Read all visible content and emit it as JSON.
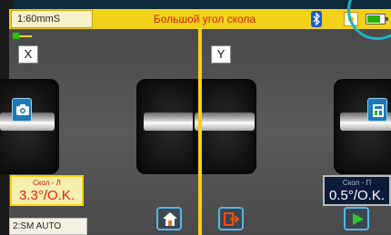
{
  "status_bar": {
    "speed": "1:60mmS",
    "title": "Большой угол скола"
  },
  "panes": {
    "x_label": "X",
    "y_label": "Y"
  },
  "cleave_left": {
    "label": "Скол - Л",
    "value": "3.3°/O.K."
  },
  "cleave_right": {
    "label": "Скол - П",
    "value": "0.5°/O.K."
  },
  "mode": "2:SM AUTO",
  "colors": {
    "status_bar": "#f2d21a",
    "title_text": "#d0201a",
    "divider": "#f2d21a",
    "button_accent": "#56b8e8",
    "cleave_left_value": "#e02010"
  },
  "icons": [
    "bluetooth-icon",
    "brightness-icon",
    "battery-icon",
    "camera-icon",
    "fiber-holder-icon",
    "home-icon",
    "exit-icon",
    "play-icon"
  ]
}
